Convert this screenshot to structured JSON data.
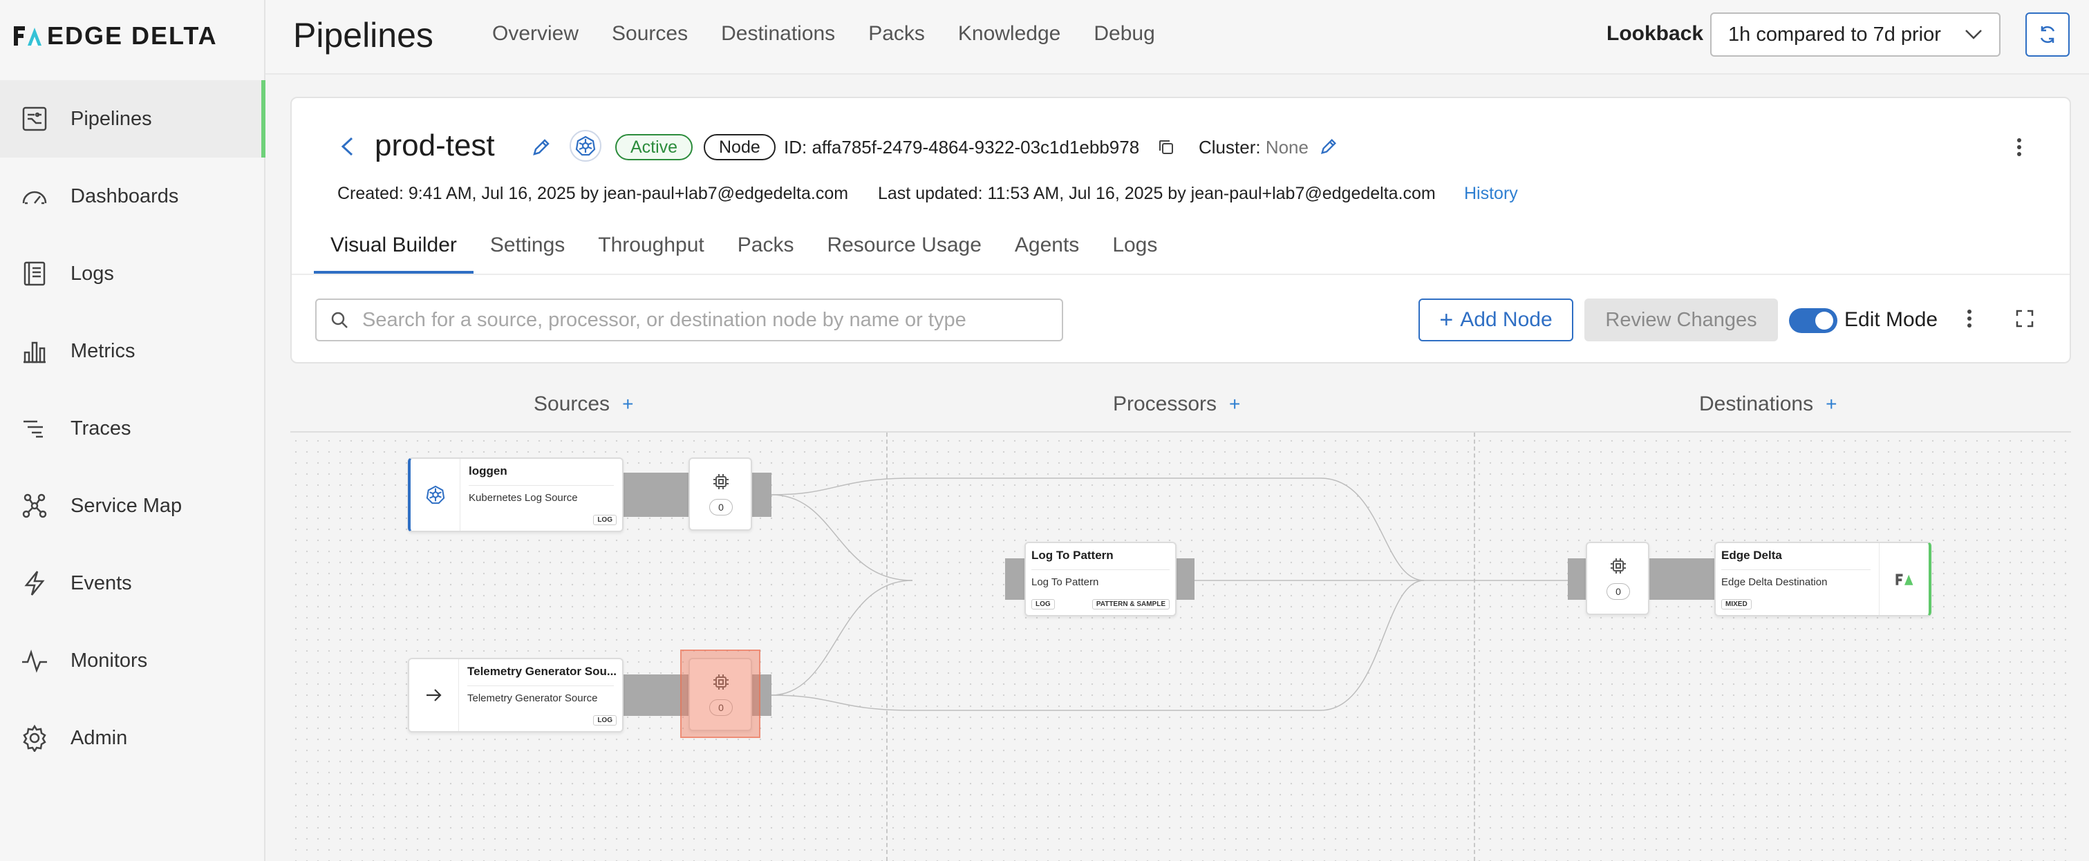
{
  "brand": {
    "name": "EDGE DELTA"
  },
  "sidebar": {
    "items": [
      {
        "label": "Pipelines",
        "icon": "pipelines-icon",
        "active": true
      },
      {
        "label": "Dashboards",
        "icon": "dashboard-icon",
        "active": false
      },
      {
        "label": "Logs",
        "icon": "logs-icon",
        "active": false
      },
      {
        "label": "Metrics",
        "icon": "metrics-icon",
        "active": false
      },
      {
        "label": "Traces",
        "icon": "traces-icon",
        "active": false
      },
      {
        "label": "Service Map",
        "icon": "service-map-icon",
        "active": false
      },
      {
        "label": "Events",
        "icon": "events-icon",
        "active": false
      },
      {
        "label": "Monitors",
        "icon": "monitors-icon",
        "active": false
      },
      {
        "label": "Admin",
        "icon": "gear-icon",
        "active": false
      }
    ]
  },
  "header": {
    "title": "Pipelines",
    "tabs": [
      "Overview",
      "Sources",
      "Destinations",
      "Packs",
      "Knowledge",
      "Debug"
    ],
    "lookback_label": "Lookback",
    "lookback_value": "1h compared to 7d prior"
  },
  "pipeline": {
    "name": "prod-test",
    "status": "Active",
    "type": "Node",
    "id_label": "ID:",
    "id": "affa785f-2479-4864-9322-03c1d1ebb978",
    "cluster_label": "Cluster:",
    "cluster_value": "None",
    "created": "Created: 9:41 AM, Jul 16, 2025 by jean-paul+lab7@edgedelta.com",
    "updated": "Last updated: 11:53 AM, Jul 16, 2025 by jean-paul+lab7@edgedelta.com",
    "history_link": "History"
  },
  "card_tabs": [
    "Visual Builder",
    "Settings",
    "Throughput",
    "Packs",
    "Resource Usage",
    "Agents",
    "Logs"
  ],
  "toolbar": {
    "search_placeholder": "Search for a source, processor, or destination node by name or type",
    "add_node_label": "Add Node",
    "review_label": "Review Changes",
    "edit_mode_label": "Edit Mode",
    "edit_mode_on": true
  },
  "canvas": {
    "columns": {
      "sources": "Sources",
      "processors": "Processors",
      "destinations": "Destinations"
    },
    "sources": [
      {
        "title": "loggen",
        "subtitle": "Kubernetes Log Source",
        "tag": "LOG",
        "icon": "kubernetes-icon",
        "pack_count": "0"
      },
      {
        "title": "Telemetry Generator Sou...",
        "subtitle": "Telemetry Generator Source",
        "tag": "LOG",
        "icon": "arrow-right-icon",
        "pack_count": "0"
      }
    ],
    "processors": [
      {
        "title": "Log To Pattern",
        "subtitle": "Log To Pattern",
        "tags": [
          "LOG",
          "PATTERN & SAMPLE"
        ]
      }
    ],
    "destinations": [
      {
        "title": "Edge Delta",
        "subtitle": "Edge Delta Destination",
        "tag": "MIXED",
        "pack_count": "0",
        "accent": "#5fc96a"
      }
    ]
  },
  "colors": {
    "accent_blue": "#2f6fc4",
    "active_green": "#2c8c3c",
    "sidebar_active": "#6fd17a",
    "highlight": "#f0785a"
  }
}
